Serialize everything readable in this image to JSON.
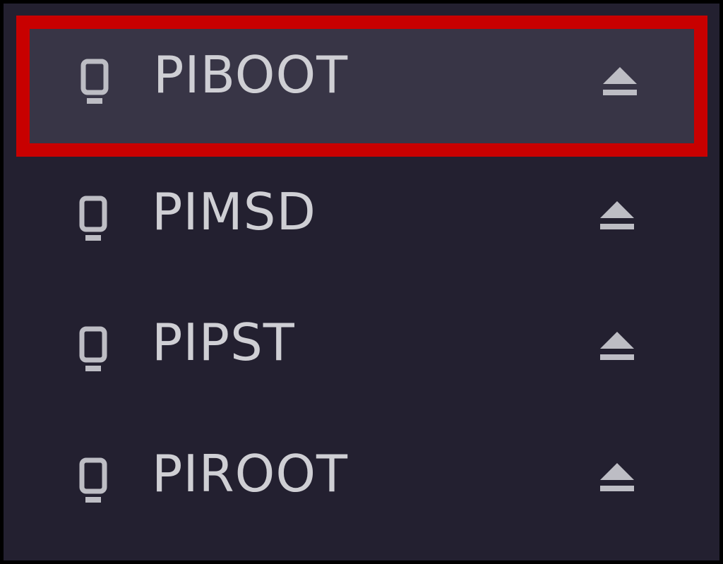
{
  "volumes": [
    {
      "label": "PIBOOT",
      "icon": "drive-icon",
      "eject_icon": "eject-icon",
      "selected": true
    },
    {
      "label": "PIMSD",
      "icon": "drive-icon",
      "eject_icon": "eject-icon",
      "selected": false
    },
    {
      "label": "PIPST",
      "icon": "drive-icon",
      "eject_icon": "eject-icon",
      "selected": false
    },
    {
      "label": "PIROOT",
      "icon": "drive-icon",
      "eject_icon": "eject-icon",
      "selected": false
    }
  ],
  "colors": {
    "background": "#232030",
    "selected_background": "#383546",
    "highlight_border": "#c80000",
    "text": "#cfcfd4",
    "icon": "#bdbdc4"
  }
}
